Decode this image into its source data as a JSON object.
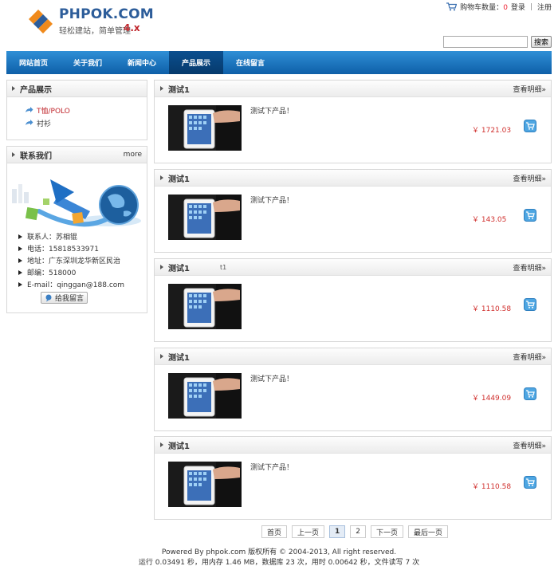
{
  "brand": {
    "name": "PHPOK.COM",
    "slogan": "轻松建站，简单管理",
    "version": "4.x"
  },
  "top_links": {
    "cart_label": "购物车数量：",
    "cart_count": "0",
    "login": "登录",
    "separator": "|",
    "register": "注册"
  },
  "search": {
    "placeholder": "",
    "button": "搜索"
  },
  "nav": [
    {
      "label": "网站首页"
    },
    {
      "label": "关于我们"
    },
    {
      "label": "新闻中心"
    },
    {
      "label": "产品展示"
    },
    {
      "label": "在线留言"
    }
  ],
  "sidebar": {
    "products": {
      "title": "产品展示",
      "items": [
        {
          "label": "T恤/POLO"
        },
        {
          "label": "衬衫"
        }
      ]
    },
    "contact": {
      "title": "联系我们",
      "more": "more",
      "items": [
        {
          "label": "联系人：苏相锟"
        },
        {
          "label": "电话：15818533971"
        },
        {
          "label": "地址：广东深圳龙华新区民治"
        },
        {
          "label": "邮编：518000"
        },
        {
          "label": "E-mail：qinggan@188.com"
        }
      ],
      "message_button": "给我留言"
    }
  },
  "products": [
    {
      "title": "测试1",
      "detail": "查看明细»",
      "desc": "测试下产品！",
      "price": "￥ 1721.03",
      "stray": ""
    },
    {
      "title": "测试1",
      "detail": "查看明细»",
      "desc": "测试下产品！",
      "price": "￥ 143.05",
      "stray": ""
    },
    {
      "title": "测试1",
      "detail": "查看明细»",
      "desc": "",
      "price": "￥ 1110.58",
      "stray": "t1"
    },
    {
      "title": "测试1",
      "detail": "查看明细»",
      "desc": "测试下产品！",
      "price": "￥ 1449.09",
      "stray": ""
    },
    {
      "title": "测试1",
      "detail": "查看明细»",
      "desc": "测试下产品！",
      "price": "￥ 1110.58",
      "stray": ""
    }
  ],
  "pagination": [
    {
      "label": "首页",
      "current": false
    },
    {
      "label": "上一页",
      "current": false
    },
    {
      "label": "1",
      "current": true
    },
    {
      "label": "2",
      "current": false
    },
    {
      "label": "下一页",
      "current": false
    },
    {
      "label": "最后一页",
      "current": false
    }
  ],
  "footer": {
    "copyright": "Powered By phpok.com 版权所有 © 2004-2013, All right reserved.",
    "stats": "运行 0.03491 秒，用内存 1.46 MB，数据库 23 次，用时 0.00642 秒，文件读写 7 次"
  },
  "colors": {
    "nav_blue": "#0e5fa8",
    "price_red": "#d0302e",
    "brand_blue": "#2d5d9a",
    "brand_red": "#c0272d"
  }
}
